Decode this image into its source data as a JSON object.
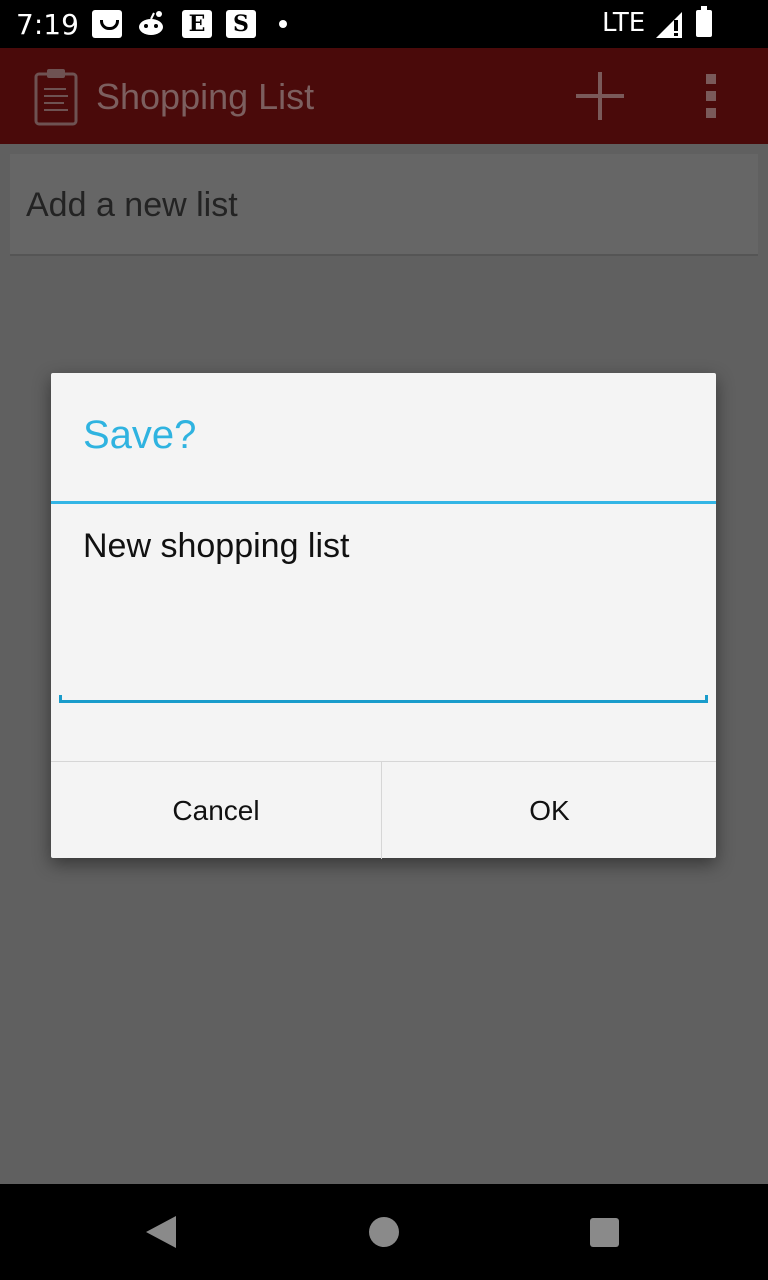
{
  "status_bar": {
    "time": "7:19",
    "notification_icons": [
      "shopping-bag-icon",
      "reddit-icon",
      "e-app-icon",
      "s-app-icon"
    ],
    "icon_e_letter": "E",
    "icon_s_letter": "S",
    "network": "LTE",
    "signal_icon": "signal-icon",
    "battery_icon": "battery-icon"
  },
  "app_bar": {
    "icon": "clipboard-icon",
    "title": "Shopping List",
    "actions": [
      "add-icon",
      "overflow-menu-icon"
    ]
  },
  "main": {
    "add_list_label": "Add a new list"
  },
  "dialog": {
    "title": "Save?",
    "input_value": "New shopping list",
    "cancel_label": "Cancel",
    "ok_label": "OK"
  },
  "nav_bar": {
    "buttons": [
      "back-icon",
      "home-icon",
      "recents-icon"
    ]
  },
  "colors": {
    "accent": "#33b5e5",
    "app_bar": "#8b1a1a",
    "dialog_background": "#f4f4f4",
    "scrim": "#606060"
  }
}
